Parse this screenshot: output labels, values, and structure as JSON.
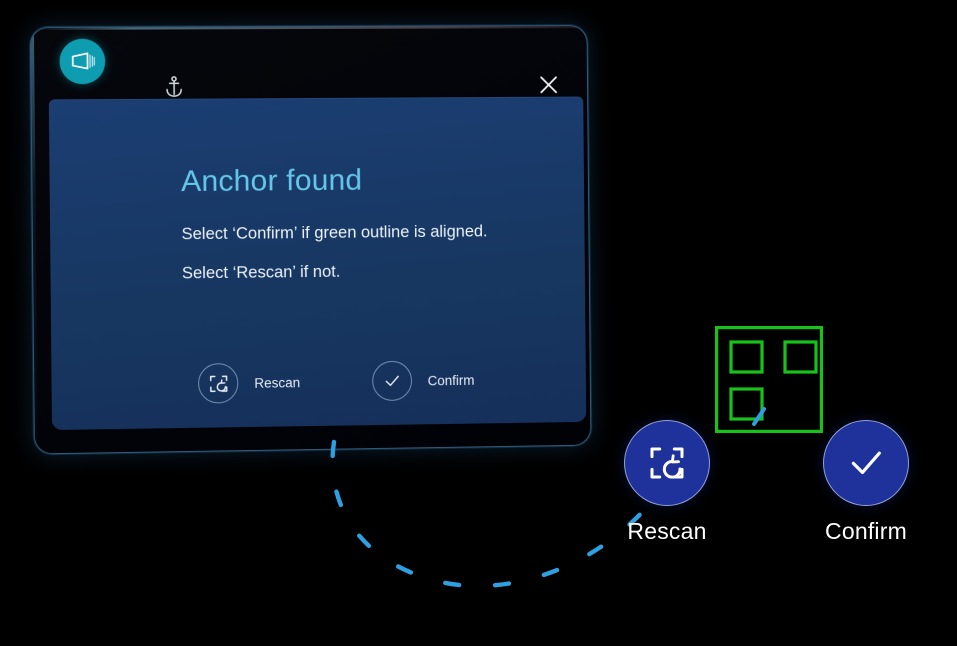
{
  "app": {
    "window_title_icons": {
      "app_icon": "slate-app-icon",
      "anchor_icon": "anchor-icon",
      "close_icon": "close-icon"
    }
  },
  "dialog": {
    "title": "Anchor found",
    "body_line_1": "Select ‘Confirm’ if green outline is aligned.",
    "body_line_2": "Select ‘Rescan’ if not.",
    "actions": [
      {
        "label": "Rescan",
        "icon": "rescan-icon"
      },
      {
        "label": "Confirm",
        "icon": "check-icon"
      }
    ]
  },
  "floating_buttons": [
    {
      "label": "Rescan",
      "icon": "rescan-icon"
    },
    {
      "label": "Confirm",
      "icon": "check-icon"
    }
  ],
  "anchor_marker": {
    "name": "green-anchor-outline",
    "finder_squares": 3
  },
  "colors": {
    "background": "#000000",
    "panel_blue": "#1b3e73",
    "title_cyan": "#64c6e8",
    "app_badge_teal": "#0e9cb0",
    "button_blue": "#1f329b",
    "anchor_green": "#19c219",
    "trail_blue": "#2e9fe0",
    "text_white": "#eef3fa"
  }
}
